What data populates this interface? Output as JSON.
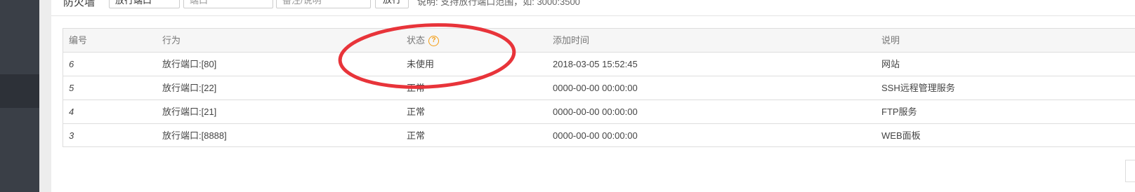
{
  "toolbar": {
    "label": "防火墙",
    "action_value": "放行端口",
    "port_placeholder": "端口",
    "remark_placeholder": "备注/说明",
    "submit_label": "放行",
    "note": "说明: 支持放行端口范围，如: 3000:3500"
  },
  "table": {
    "headers": {
      "id": "编号",
      "action": "行为",
      "status": "状态",
      "added": "添加时间",
      "remark": "说明"
    },
    "help_icon": "question-icon",
    "rows": [
      {
        "id": "6",
        "action": "放行端口:[80]",
        "status": "未使用",
        "added": "2018-03-05 15:52:45",
        "remark": "网站"
      },
      {
        "id": "5",
        "action": "放行端口:[22]",
        "status": "正常",
        "added": "0000-00-00 00:00:00",
        "remark": "SSH远程管理服务"
      },
      {
        "id": "4",
        "action": "放行端口:[21]",
        "status": "正常",
        "added": "0000-00-00 00:00:00",
        "remark": "FTP服务"
      },
      {
        "id": "3",
        "action": "放行端口:[8888]",
        "status": "正常",
        "added": "0000-00-00 00:00:00",
        "remark": "WEB面板"
      }
    ]
  },
  "colors": {
    "annotation": "#e8343a",
    "help": "#f39c12",
    "sidebar": "#3a3f47"
  }
}
